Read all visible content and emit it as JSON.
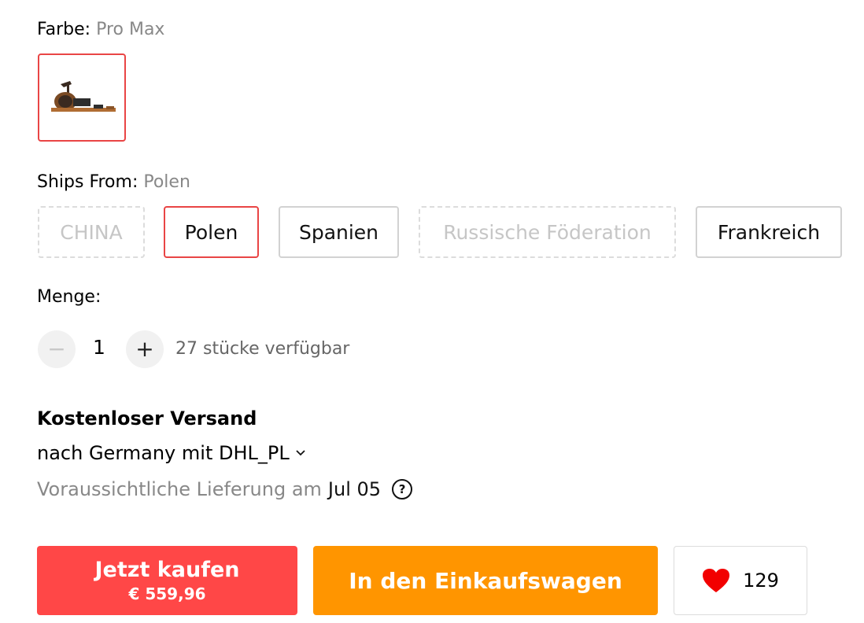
{
  "color": {
    "label": "Farbe:",
    "value": "Pro Max"
  },
  "ships_from": {
    "label": "Ships From:",
    "value": "Polen",
    "options": [
      "CHINA",
      "Polen",
      "Spanien",
      "Russische Föderation",
      "Frankreich"
    ]
  },
  "quantity": {
    "label": "Menge:",
    "value": "1",
    "minus": "−",
    "plus": "+",
    "available": "27 stücke verfügbar"
  },
  "shipping": {
    "title": "Kostenloser Versand",
    "destination": "nach Germany mit DHL_PL",
    "delivery_label": "Voraussichtliche Lieferung am",
    "delivery_date": "Jul 05",
    "help": "?"
  },
  "actions": {
    "buy_label": "Jetzt kaufen",
    "buy_price": "€ 559,96",
    "cart_label": "In den Einkaufswagen",
    "wishlist_count": "129"
  },
  "colors": {
    "accent_red": "#ff4747",
    "selected_border": "#e94545",
    "cart_orange": "#ff9500"
  }
}
